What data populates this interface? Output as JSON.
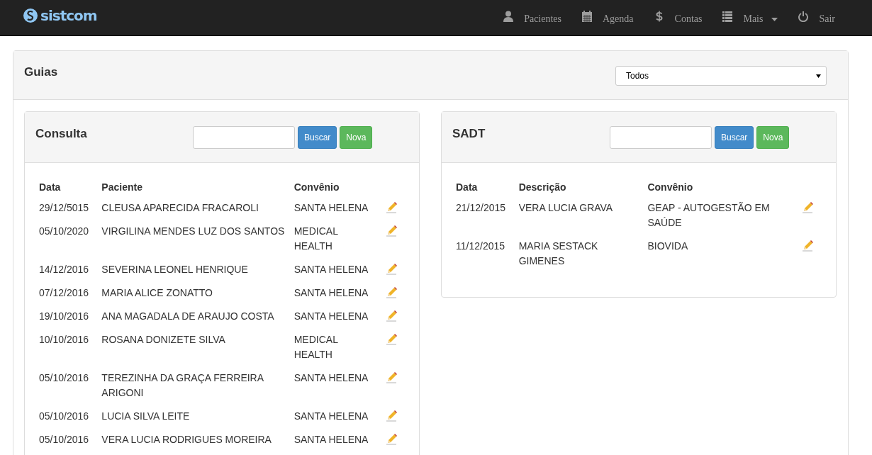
{
  "brand": {
    "logo_text": "sistcom"
  },
  "nav": [
    {
      "kind": "user",
      "label": "Pacientes"
    },
    {
      "kind": "calendar",
      "label": "Agenda"
    },
    {
      "kind": "dollar",
      "label": "Contas"
    },
    {
      "kind": "list",
      "label": "Mais",
      "dropdown": true
    },
    {
      "kind": "power",
      "label": "Sair"
    }
  ],
  "page": {
    "title": "Guias",
    "filter": {
      "value": "Todos"
    }
  },
  "panels": [
    {
      "title": "Consulta",
      "search_button": "Buscar",
      "new_button": "Nova",
      "columns": [
        "Data",
        "Paciente",
        "Convênio"
      ],
      "rows": [
        {
          "cells": [
            "29/12/5015",
            "CLEUSA APARECIDA FRACAROLI",
            "SANTA HELENA"
          ]
        },
        {
          "cells": [
            "05/10/2020",
            "VIRGILINA MENDES LUZ DOS SANTOS",
            "MEDICAL HEALTH"
          ]
        },
        {
          "cells": [
            "14/12/2016",
            "SEVERINA LEONEL HENRIQUE",
            "SANTA HELENA"
          ]
        },
        {
          "cells": [
            "07/12/2016",
            "MARIA ALICE ZONATTO",
            "SANTA HELENA"
          ]
        },
        {
          "cells": [
            "19/10/2016",
            "ANA MAGADALA DE ARAUJO COSTA",
            "SANTA HELENA"
          ]
        },
        {
          "cells": [
            "10/10/2016",
            "ROSANA DONIZETE SILVA",
            "MEDICAL HEALTH"
          ]
        },
        {
          "cells": [
            "05/10/2016",
            "TEREZINHA DA GRAÇA FERREIRA ARIGONI",
            "SANTA HELENA"
          ]
        },
        {
          "cells": [
            "05/10/2016",
            "LUCIA SILVA LEITE",
            "SANTA HELENA"
          ]
        },
        {
          "cells": [
            "05/10/2016",
            "VERA LUCIA RODRIGUES MOREIRA",
            "SANTA HELENA"
          ]
        }
      ]
    },
    {
      "title": "SADT",
      "search_button": "Buscar",
      "new_button": "Nova",
      "columns": [
        "Data",
        "Descrição",
        "Convênio"
      ],
      "rows": [
        {
          "cells": [
            "21/12/2015",
            "VERA LUCIA GRAVA",
            "GEAP - AUTOGESTÃO EM SAÚDE"
          ]
        },
        {
          "cells": [
            "11/12/2015",
            "MARIA SESTACK GIMENES",
            "BIOVIDA"
          ]
        }
      ]
    }
  ]
}
